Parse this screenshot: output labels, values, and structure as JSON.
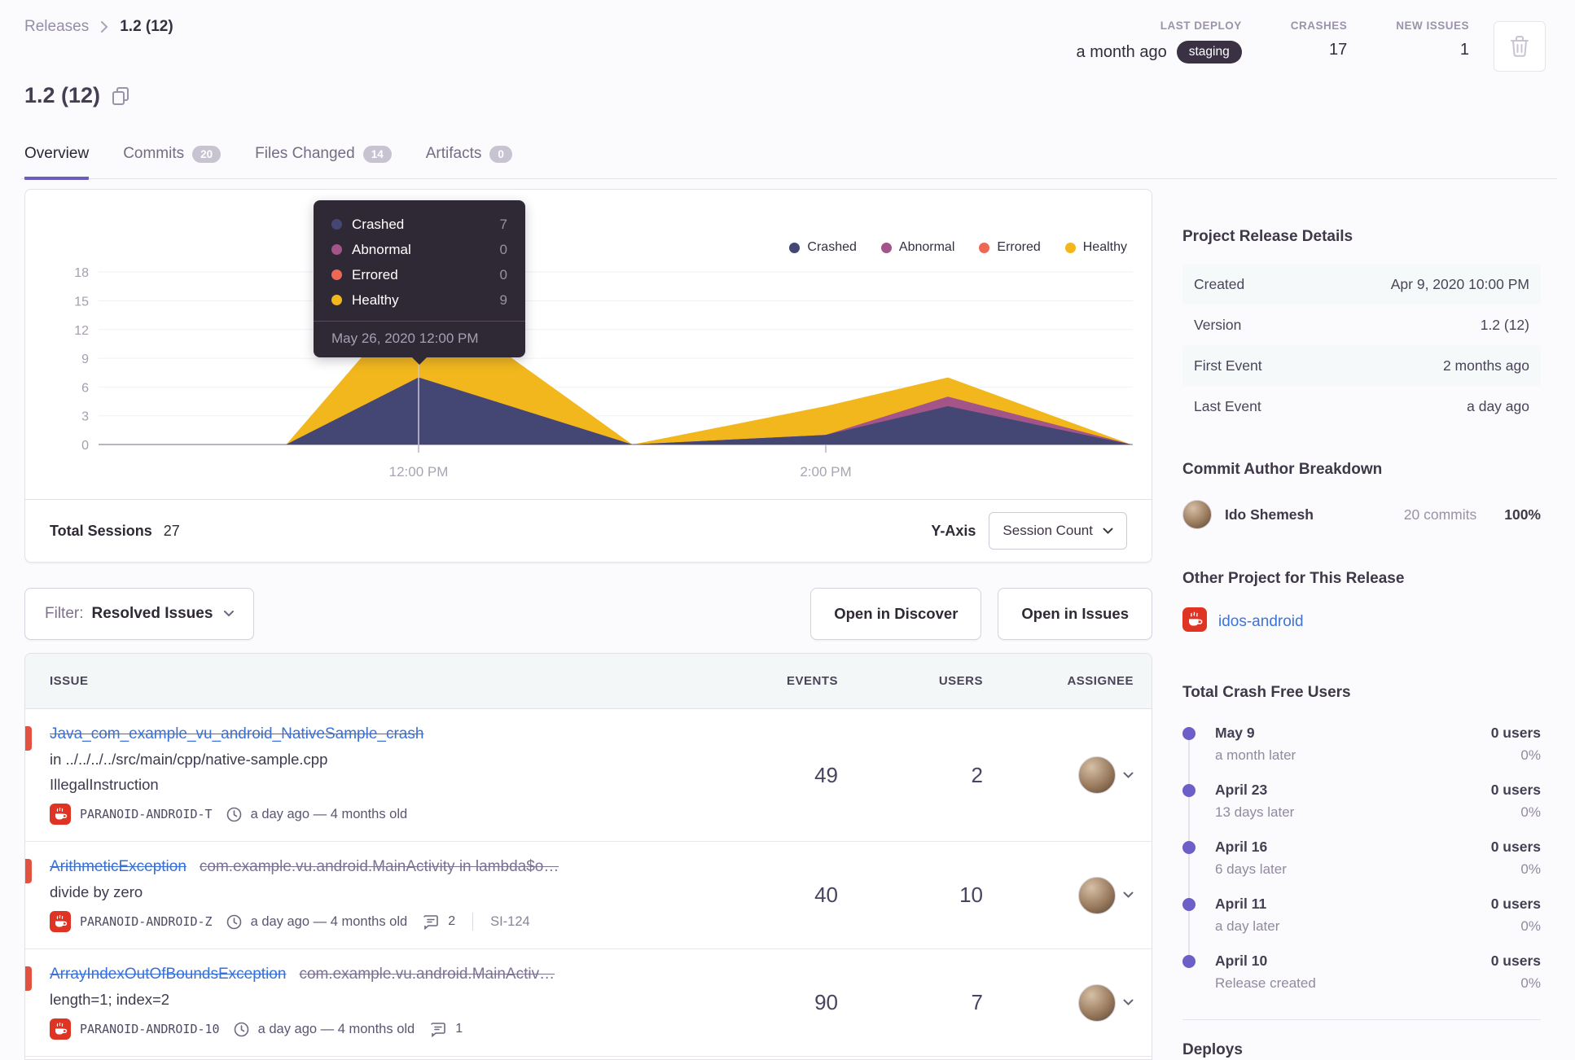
{
  "breadcrumb": {
    "root": "Releases",
    "current": "1.2 (12)"
  },
  "header": {
    "title": "1.2 (12)",
    "stats": [
      {
        "label": "LAST DEPLOY",
        "value": "a month ago",
        "badge": "staging"
      },
      {
        "label": "CRASHES",
        "value": "17"
      },
      {
        "label": "NEW ISSUES",
        "value": "1"
      }
    ]
  },
  "tabs": [
    {
      "label": "Overview",
      "active": true
    },
    {
      "label": "Commits",
      "badge": "20"
    },
    {
      "label": "Files Changed",
      "badge": "14"
    },
    {
      "label": "Artifacts",
      "badge": "0"
    }
  ],
  "chart_data": {
    "type": "area",
    "stacked": true,
    "x_hours": [
      11.35,
      12,
      13.05,
      14,
      14.6,
      15.5
    ],
    "series": [
      {
        "name": "Crashed",
        "color": "#444674",
        "values": [
          0,
          7,
          0,
          1,
          4,
          0
        ]
      },
      {
        "name": "Abnormal",
        "color": "#a35488",
        "values": [
          0,
          0,
          0,
          0,
          1,
          0
        ]
      },
      {
        "name": "Errored",
        "color": "#ec6855",
        "values": [
          0,
          0,
          0,
          0,
          0,
          0
        ]
      },
      {
        "name": "Healthy",
        "color": "#f1b71c",
        "values": [
          0,
          9,
          0,
          3,
          2,
          0
        ]
      }
    ],
    "y_ticks": [
      0,
      3,
      6,
      9,
      12,
      15,
      18
    ],
    "x_axis_labels": [
      {
        "label": "12:00 PM",
        "hour": 12
      },
      {
        "label": "2:00 PM",
        "hour": 14
      }
    ],
    "tooltip": {
      "rows": [
        {
          "name": "Crashed",
          "value": "7"
        },
        {
          "name": "Abnormal",
          "value": "0"
        },
        {
          "name": "Errored",
          "value": "0"
        },
        {
          "name": "Healthy",
          "value": "9"
        }
      ],
      "footer": "May 26, 2020 12:00 PM",
      "anchor_hour": 12
    }
  },
  "chart_footer": {
    "total_label": "Total Sessions",
    "total_value": "27",
    "yaxis_label": "Y-Axis",
    "yaxis_value": "Session Count"
  },
  "filter_bar": {
    "filter_label": "Filter:",
    "filter_value": "Resolved Issues",
    "discover_button": "Open in Discover",
    "issues_button": "Open in Issues"
  },
  "issues_table": {
    "columns": [
      "ISSUE",
      "EVENTS",
      "USERS",
      "ASSIGNEE"
    ],
    "rows": [
      {
        "title": "Java_com_example_vu_android_NativeSample_crash",
        "culprit": null,
        "lines": [
          "in ../../../../src/main/cpp/native-sample.cpp",
          "IllegalInstruction"
        ],
        "project": "PARANOID-ANDROID-T",
        "age": "a day ago — 4 months old",
        "comments": null,
        "ref": null,
        "events": "49",
        "users": "2"
      },
      {
        "title": "ArithmeticException",
        "culprit": "com.example.vu.android.MainActivity in lambda$o…",
        "lines": [
          "divide by zero"
        ],
        "project": "PARANOID-ANDROID-Z",
        "age": "a day ago — 4 months old",
        "comments": "2",
        "ref": "SI-124",
        "events": "40",
        "users": "10"
      },
      {
        "title": "ArrayIndexOutOfBoundsException",
        "culprit": "com.example.vu.android.MainActiv…",
        "lines": [
          "length=1; index=2"
        ],
        "project": "PARANOID-ANDROID-10",
        "age": "a day ago — 4 months old",
        "comments": "1",
        "ref": null,
        "events": "90",
        "users": "7"
      }
    ]
  },
  "sidebar": {
    "release_details": {
      "heading": "Project Release Details",
      "rows": [
        {
          "label": "Created",
          "value": "Apr 9, 2020 10:00 PM"
        },
        {
          "label": "Version",
          "value": "1.2 (12)"
        },
        {
          "label": "First Event",
          "value": "2 months ago"
        },
        {
          "label": "Last Event",
          "value": "a day ago"
        }
      ]
    },
    "commit_authors": {
      "heading": "Commit Author Breakdown",
      "rows": [
        {
          "name": "Ido Shemesh",
          "commits": "20 commits",
          "percent": "100%"
        }
      ]
    },
    "other_project": {
      "heading": "Other Project for This Release",
      "project": "idos-android"
    },
    "crash_free": {
      "heading": "Total Crash Free Users",
      "entries": [
        {
          "date": "May 9",
          "note": "a month later",
          "users": "0 users",
          "percent": "0%"
        },
        {
          "date": "April 23",
          "note": "13 days later",
          "users": "0 users",
          "percent": "0%"
        },
        {
          "date": "April 16",
          "note": "6 days later",
          "users": "0 users",
          "percent": "0%"
        },
        {
          "date": "April 11",
          "note": "a day later",
          "users": "0 users",
          "percent": "0%"
        },
        {
          "date": "April 10",
          "note": "Release created",
          "users": "0 users",
          "percent": "0%"
        }
      ]
    },
    "deploys": {
      "heading": "Deploys"
    }
  },
  "colors": {
    "accent": "#6c5fc7",
    "link": "#3b74dd",
    "danger": "#e35141",
    "tooltip_bg": "#2f2936"
  }
}
